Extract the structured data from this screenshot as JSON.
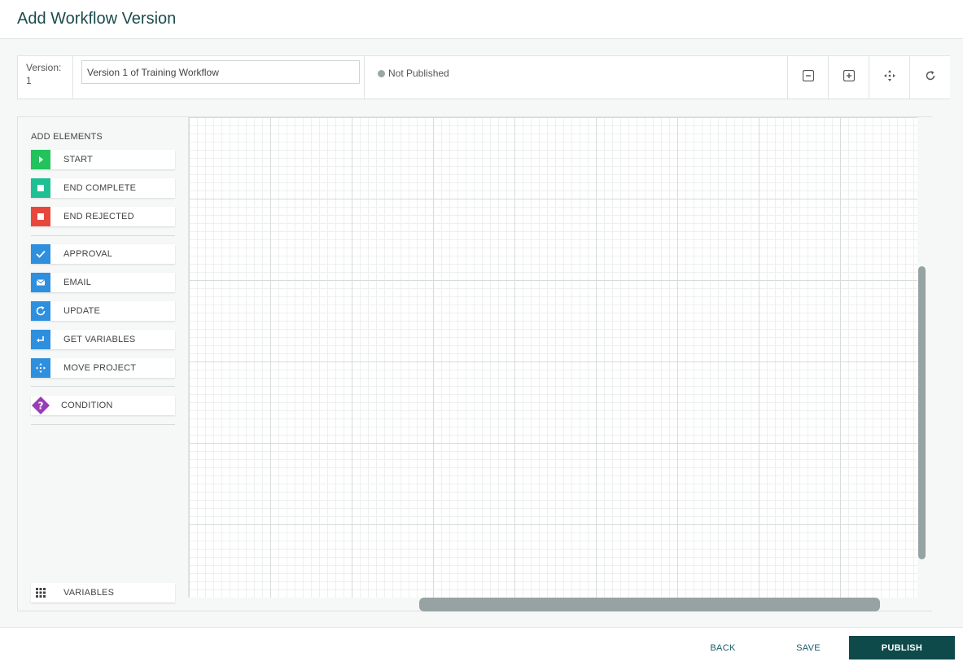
{
  "page": {
    "title": "Add Workflow Version"
  },
  "toolbar": {
    "version_label": "Version:",
    "version_number": "1",
    "name_value": "Version 1 of Training Workflow",
    "status": "Not Published",
    "buttons": [
      "zoom-out-icon",
      "zoom-in-icon",
      "fit-move-icon",
      "reset-icon"
    ]
  },
  "elements_panel": {
    "title": "ADD ELEMENTS",
    "items": [
      {
        "label": "START",
        "icon": "play-icon",
        "color": "#22c25d"
      },
      {
        "label": "END COMPLETE",
        "icon": "square-icon",
        "color": "#1fbf94"
      },
      {
        "label": "END REJECTED",
        "icon": "square-icon",
        "color": "#e8483c"
      },
      {
        "label": "APPROVAL",
        "icon": "check-icon",
        "color": "#2d8fde"
      },
      {
        "label": "EMAIL",
        "icon": "envelope-icon",
        "color": "#2d8fde"
      },
      {
        "label": "UPDATE",
        "icon": "refresh-icon",
        "color": "#2d8fde"
      },
      {
        "label": "GET VARIABLES",
        "icon": "return-arrow-icon",
        "color": "#2d8fde"
      },
      {
        "label": "MOVE PROJECT",
        "icon": "move-arrows-icon",
        "color": "#2d8fde"
      },
      {
        "label": "CONDITION",
        "icon": "question-diamond-icon",
        "color": "#9b3cb7"
      }
    ],
    "variables": {
      "label": "VARIABLES",
      "icon": "grid-icon"
    }
  },
  "footer": {
    "back": "BACK",
    "save": "SAVE",
    "publish": "PUBLISH"
  },
  "colors": {
    "title": "#1b4b4b",
    "publish_bg": "#0e4a4a",
    "link": "#1b5e6b",
    "scroll_thumb": "#97a3a3",
    "status_dot": "#9aa5a5"
  }
}
